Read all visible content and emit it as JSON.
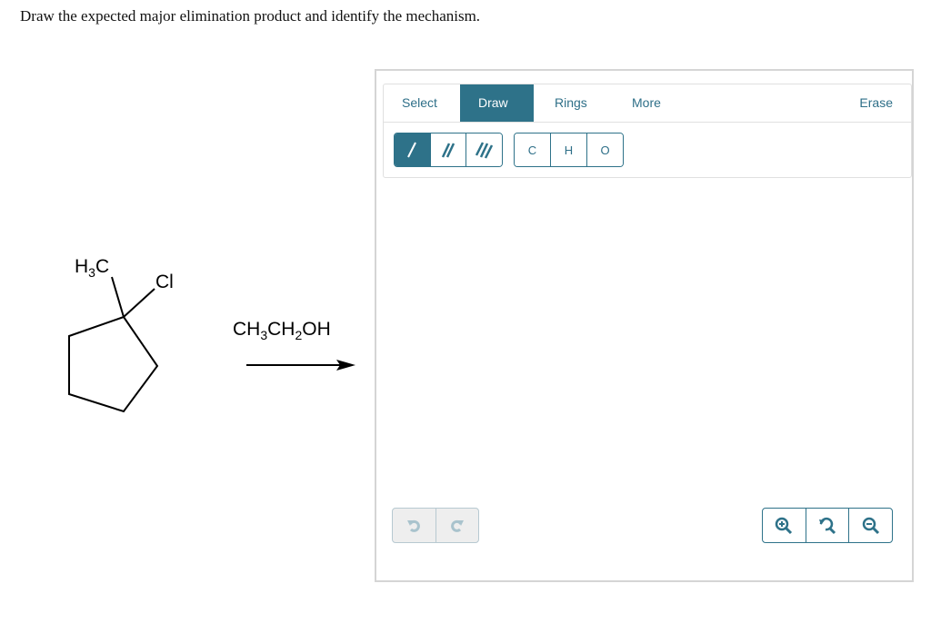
{
  "question": "Draw the expected major elimination product and identify the mechanism.",
  "reaction": {
    "reactant": {
      "substituent_1": "H3C",
      "substituent_2": "Cl",
      "ring": "cyclopentane"
    },
    "reagent": "CH3CH2OH"
  },
  "editor": {
    "tabs": [
      {
        "label": "Select",
        "active": false
      },
      {
        "label": "Draw",
        "active": true
      },
      {
        "label": "Rings",
        "active": false
      },
      {
        "label": "More",
        "active": false
      },
      {
        "label": "Erase",
        "active": false
      }
    ],
    "bond_tools": [
      {
        "name": "single-bond",
        "icon": "single-bond-icon",
        "active": true
      },
      {
        "name": "double-bond",
        "icon": "double-bond-icon",
        "active": false
      },
      {
        "name": "triple-bond",
        "icon": "triple-bond-icon",
        "active": false
      }
    ],
    "atom_tools": [
      {
        "label": "C"
      },
      {
        "label": "H"
      },
      {
        "label": "O"
      }
    ],
    "history": [
      {
        "icon": "undo-icon"
      },
      {
        "icon": "redo-icon"
      }
    ],
    "zoom": [
      {
        "icon": "zoom-in-icon"
      },
      {
        "icon": "zoom-reset-icon"
      },
      {
        "icon": "zoom-out-icon"
      }
    ],
    "accent_color": "#2e7289"
  }
}
